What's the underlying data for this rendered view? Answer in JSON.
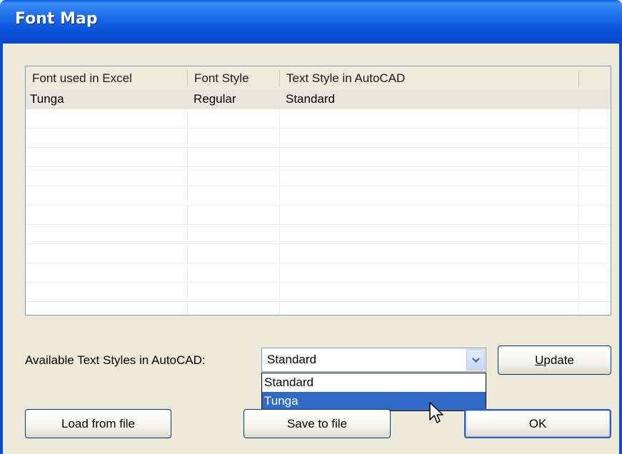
{
  "window": {
    "title": "Font Map"
  },
  "table": {
    "columns": [
      "Font used in Excel",
      "Font Style",
      "Text Style in AutoCAD"
    ],
    "rows": [
      {
        "font": "Tunga",
        "style": "Regular",
        "text_style": "Standard"
      }
    ]
  },
  "available": {
    "label": "Available Text Styles in AutoCAD:",
    "selected": "Standard",
    "options": [
      "Standard",
      "Tunga"
    ],
    "highlighted": "Tunga"
  },
  "buttons": {
    "update_u": "U",
    "update_rest": "pdate",
    "load": "Load from file",
    "save": "Save to file",
    "ok": "OK"
  },
  "colors": {
    "titlebar": "#0A53D8",
    "dialog_bg": "#ECE9D8",
    "highlight": "#316AC5",
    "selected_row": "#E9E7DD"
  }
}
